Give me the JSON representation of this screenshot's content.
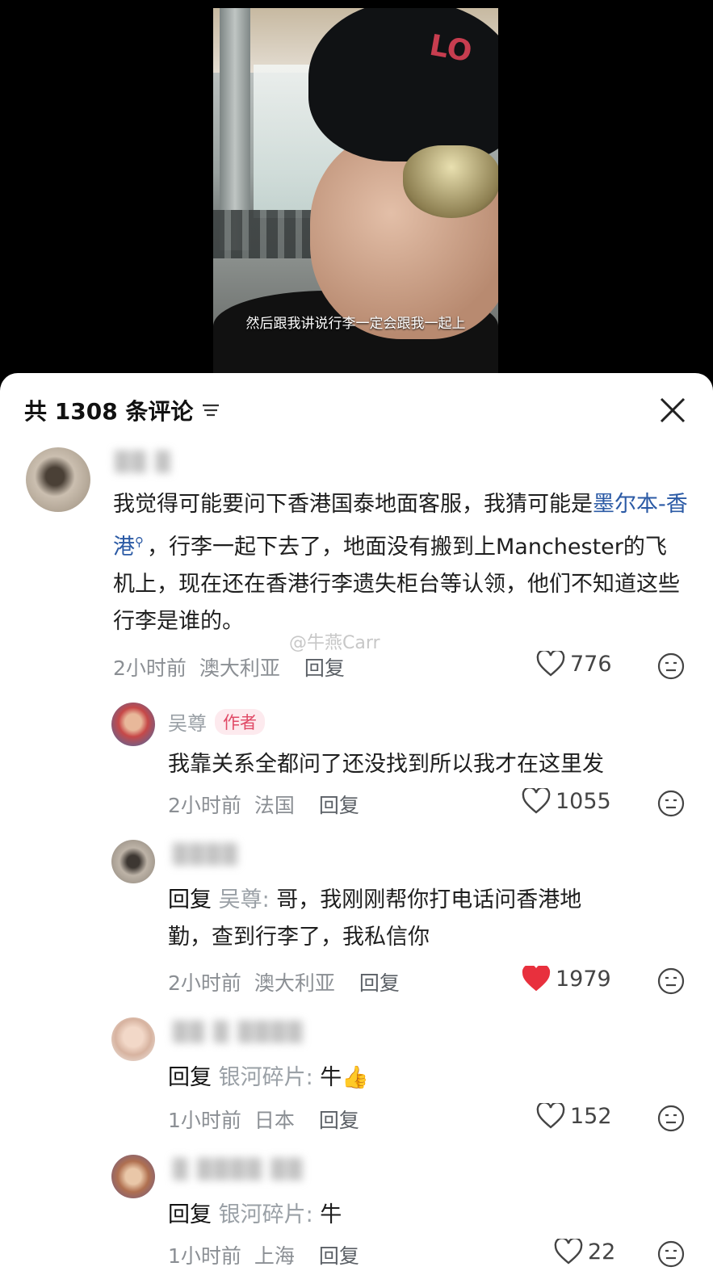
{
  "video": {
    "caption": "然后跟我讲说行李一定会跟我一起上",
    "cap_logo": "LO"
  },
  "comments_panel": {
    "count_label": "共 1308 条评论",
    "watermark": "@牛燕Carr"
  },
  "comments": [
    {
      "username": "▒▒ ▒",
      "text_before_link": "我觉得可能要问下香港国泰地面客服，我猜可能是",
      "link_text": "墨尔本-香港",
      "text_after_link": "，行李一起下去了，地面没有搬到上Manchester的飞机上，现在还在香港行李遗失柜台等认领，他们不知道这些行李是谁的。",
      "time": "2小时前",
      "location": "澳大利亚",
      "reply_label": "回复",
      "likes": "776"
    },
    {
      "username": "吴尊",
      "badge": "作者",
      "text": "我靠关系全都问了还没找到所以我才在这里发",
      "time": "2小时前",
      "location": "法国",
      "reply_label": "回复",
      "likes": "1055"
    },
    {
      "username": "▒▒▒▒",
      "reply_prefix": "回复",
      "reply_target": "吴尊:",
      "text_line1": "哥，我刚刚帮你打电话问香港地",
      "text_line2": "勤，查到行李了，我私信你",
      "time": "2小时前",
      "location": "澳大利亚",
      "reply_label": "回复",
      "likes": "1979"
    },
    {
      "username": "▒▒ ▒ ▒▒▒▒",
      "reply_prefix": "回复",
      "reply_target": "银河碎片:",
      "text": "牛👍",
      "time": "1小时前",
      "location": "日本",
      "reply_label": "回复",
      "likes": "152"
    },
    {
      "username": "▒ ▒▒▒▒ ▒▒",
      "reply_prefix": "回复",
      "reply_target": "银河碎片:",
      "text": "牛",
      "time": "1小时前",
      "location": "上海",
      "reply_label": "回复",
      "likes": "22"
    }
  ],
  "colors": {
    "link": "#2b5aa5",
    "liked_heart": "#e8303d",
    "author_badge": "#e04a66"
  }
}
